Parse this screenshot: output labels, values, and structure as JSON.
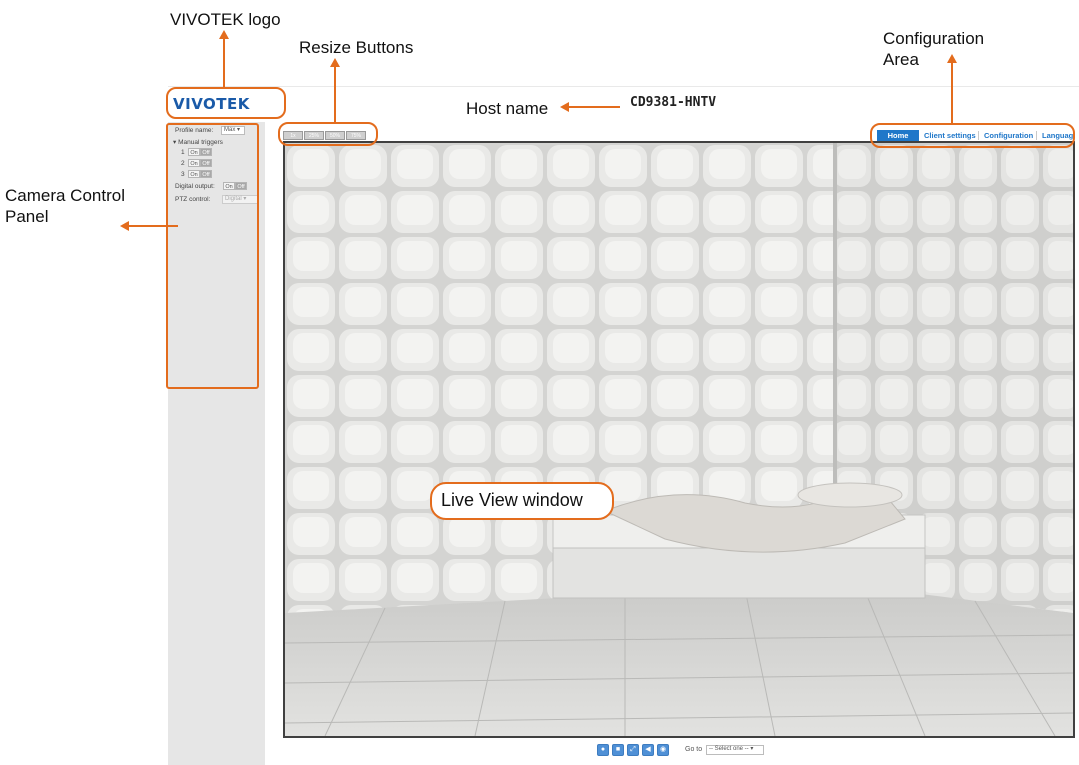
{
  "annotations": {
    "logo": "VIVOTEK logo",
    "resize": "Resize Buttons",
    "configuration_line1": "Configuration",
    "configuration_line2": "Area",
    "hostname": "Host name",
    "camera_panel_line1": "Camera Control",
    "camera_panel_line2": "Panel",
    "live_view": "Live View window"
  },
  "header": {
    "logo_text": "VIVOTEK",
    "host_name": "CD9381-HNTV"
  },
  "nav": {
    "home": "Home",
    "client_settings": "Client settings",
    "configuration": "Configuration",
    "language": "Language"
  },
  "resize_buttons": [
    "1x",
    "25%",
    "50%",
    "75%"
  ],
  "sidebar": {
    "profile_label": "Profile name:",
    "profile_value": "Max",
    "manual_triggers_label": "Manual triggers",
    "triggers": [
      {
        "index": "1",
        "on": "On",
        "off": "Off"
      },
      {
        "index": "2",
        "on": "On",
        "off": "Off"
      },
      {
        "index": "3",
        "on": "On",
        "off": "Off"
      }
    ],
    "digital_output_label": "Digital output:",
    "digital_output_on": "On",
    "digital_output_off": "Off",
    "ptz_label": "PTZ control:",
    "ptz_value": "Digital"
  },
  "toolbar": {
    "icons": [
      "snapshot-icon",
      "record-icon",
      "full-screen-icon",
      "volume-icon",
      "talk-icon"
    ],
    "goto_label": "Go to",
    "goto_value": "-- Select one --"
  },
  "colors": {
    "annotation_orange": "#e36c1d",
    "vivotek_blue": "#1a5aa8",
    "nav_blue": "#1f77c9"
  }
}
